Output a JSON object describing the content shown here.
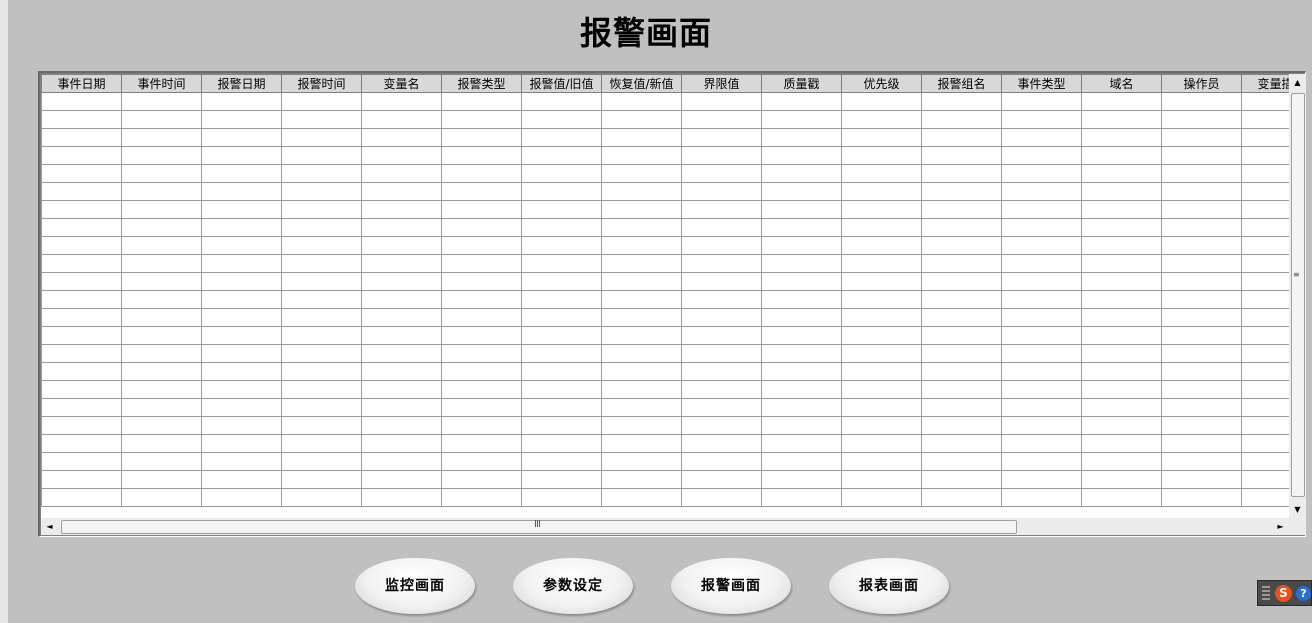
{
  "page_title": "报警画面",
  "alarm_table": {
    "columns": [
      "事件日期",
      "事件时间",
      "报警日期",
      "报警时间",
      "变量名",
      "报警类型",
      "报警值/旧值",
      "恢复值/新值",
      "界限值",
      "质量戳",
      "优先级",
      "报警组名",
      "事件类型",
      "域名",
      "操作员",
      "变量描述"
    ],
    "visible_row_count": 23
  },
  "scrollbars": {
    "up_arrow": "▲",
    "down_arrow": "▼",
    "left_arrow": "◄",
    "right_arrow": "►",
    "vertical_grip": "≡",
    "horizontal_grip": "Ⅲ"
  },
  "nav_buttons": [
    {
      "label": "监控画面"
    },
    {
      "label": "参数设定"
    },
    {
      "label": "报警画面"
    },
    {
      "label": "报表画面"
    }
  ],
  "tray": {
    "ime_icon_label": "S",
    "help_icon_label": "?"
  }
}
